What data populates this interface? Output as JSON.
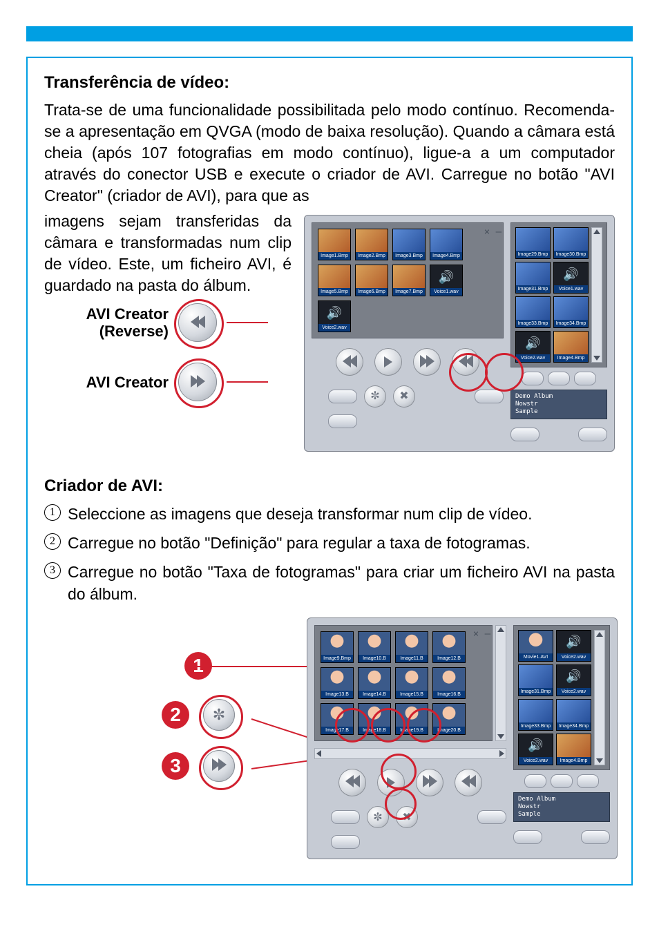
{
  "section1": {
    "heading": "Transferência de vídeo:",
    "para1": "Trata-se de uma funcionalidade possibilitada pelo modo contínuo. Recomenda-se a apresentação em QVGA (modo de baixa resolução). Quando a câmara está cheia (após 107 fotografias em modo contínuo), ligue-a a um computador através do conector USB e execute o criador de AVI. Carregue no botão \"AVI Creator\" (criador de AVI), para que as",
    "para2": "imagens sejam transferidas da câmara e transformadas num clip de vídeo. Este, um ficheiro AVI, é guardado na pasta do álbum.",
    "label_reverse_l1": "AVI Creator",
    "label_reverse_l2": "(Reverse)",
    "label_creator": "AVI Creator"
  },
  "section2": {
    "heading": "Criador de AVI:",
    "step1": "Seleccione as imagens que deseja transformar num clip de vídeo.",
    "step2": "Carregue no botão \"Definição\" para regular a taxa de fotogramas.",
    "step3": "Carregue no botão \"Taxa de fotogramas\" para criar um ficheiro AVI na pasta do álbum."
  },
  "app1": {
    "thumbs_row1": [
      "Image1.Bmp",
      "Image2.Bmp",
      "Image3.Bmp",
      "Image4.Bmp"
    ],
    "thumbs_row2": [
      "Image5.Bmp",
      "Image6.Bmp",
      "Image7.Bmp"
    ],
    "sound_row2": "Voice1.wav",
    "sound_row3": "Voice2.wav",
    "side_left": [
      "Image29.Bmp",
      "Image31.Bmp",
      "Image33.Bmp"
    ],
    "side_right_top": "Image30.Bmp",
    "side_right_snd1": "Voice1.wav",
    "side_right_img": "Image34.Bmp",
    "side_right_snd2": "Voice2.wav",
    "side_right_img2": "Image4.Bmp",
    "info_lines": [
      "Demo Album",
      "Nowstr",
      "Sample"
    ]
  },
  "app2": {
    "thumbs_row1": [
      "Image9.Bmp",
      "Image10.B",
      "Image11.B",
      "Image12.B"
    ],
    "thumbs_row2": [
      "Image13.B",
      "Image14.B",
      "Image15.B",
      "Image16.B"
    ],
    "thumbs_row3": [
      "Image17.B",
      "Image18.B",
      "Image19.B",
      "Image20.B"
    ],
    "side_left_top": "Movie1.AVI",
    "side_right_snd1": "Voice2.wav",
    "side_left": [
      "Image31.Bmp",
      "Image33.Bmp"
    ],
    "side_right_snd2": "Voice2.wav",
    "side_right_img": "Image34.Bmp",
    "side_right_snd3": "Voice2.wav",
    "side_right_img2": "Image4.Bmp",
    "info_lines": [
      "Demo Album",
      "Nowstr",
      "Sample"
    ]
  },
  "legend": {
    "n1": "1",
    "n2": "2",
    "n3": "3"
  }
}
